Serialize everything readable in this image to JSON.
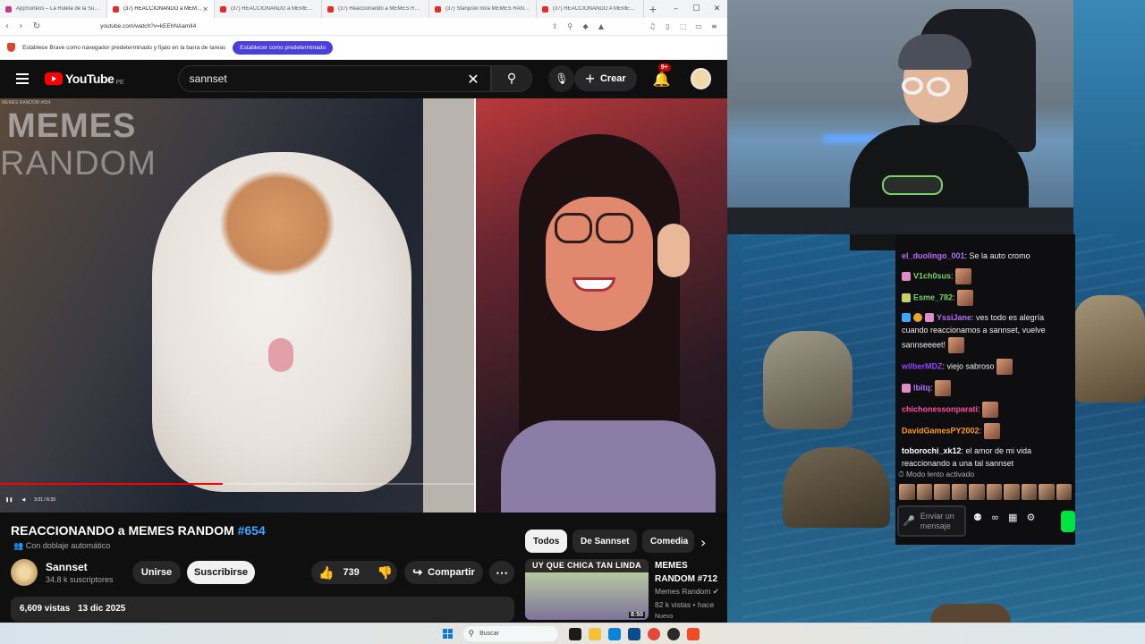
{
  "browser": {
    "tabs": [
      {
        "title": "AppSorteos – La Ruleta de la Suerte"
      },
      {
        "title": "(37) REACCIONANDO a MEMES R"
      },
      {
        "title": "(37) REACCIONANDO a MEMES RANDOM"
      },
      {
        "title": "(37) Reaccionando a MEMES RANDOM"
      },
      {
        "title": "(37) Stanjuski mira MEMES RANDOM"
      },
      {
        "title": "(37) REACCIONANDO A MEMES RANDOM"
      }
    ],
    "url": "youtube.com/watch?v=kEEhNAamlI4",
    "infobar_text": "Establece Brave como navegador predeterminado y fíjalo en la barra de tareas",
    "infobar_button": "Establecer como predeterminado"
  },
  "youtube": {
    "logo_text": "YouTube",
    "region": "PE",
    "search_value": "sannset",
    "create_label": "Crear",
    "notif_badge": "9+",
    "video": {
      "watermark_small": "MEMES RANDOM #654",
      "watermark_line1": "MEMES",
      "watermark_line2": "RANDOM",
      "time": "3:21 / 6:33",
      "progress": 0.47
    },
    "title_main": "REACCIONANDO a MEMES RANDOM ",
    "title_hash": "#654",
    "dubbing": "Con doblaje automático",
    "channel_name": "Sannset",
    "channel_subs": "34.8 k suscriptores",
    "join_label": "Unirse",
    "subscribe_label": "Suscribirse",
    "likes": "739",
    "share_label": "Compartir",
    "views": "6,609 vistas",
    "date": "13 dic 2025",
    "chips": [
      "Todos",
      "De Sannset",
      "Comedia"
    ],
    "rec": {
      "thumb_text": "UY QUE CHICA TAN LINDA",
      "duration": "8:50",
      "title": "MEMES RANDOM #712",
      "channel": "Memes Random",
      "meta": "82 k vistas • hace",
      "badge": "Nuevo"
    }
  },
  "chat": {
    "messages": [
      {
        "user": "el_duolingo_001",
        "color": "#9146ff",
        "text": ": Se la auto cromo",
        "emote": false
      },
      {
        "user": "V1ch0sus",
        "color": "#7ad36a",
        "text": ":",
        "emote": true
      },
      {
        "user": "Esme_782",
        "color": "#7ad36a",
        "text": ":",
        "emote": true
      },
      {
        "user": "YssiJane",
        "color": "#b76cff",
        "text": ": ves todo es alegría cuando reaccionamos a sannset, vuelve sannseeeet!",
        "emote": true
      },
      {
        "user": "wilberMDZ",
        "color": "#9146ff",
        "text": ": viejo sabroso",
        "emote": true
      },
      {
        "user": "lbitq",
        "color": "#b76cff",
        "text": ":",
        "emote": true
      },
      {
        "user": "chichonessonparati",
        "color": "#ff4fa3",
        "text": ":",
        "emote": true
      },
      {
        "user": "DavidGamesPY2002",
        "color": "#ff9a1f",
        "text": ":",
        "emote": true
      },
      {
        "user": "toborochi_xk12",
        "color": "#ffffff",
        "text": ": el amor de mi vida reaccionando a una tal sannset",
        "emote": false
      }
    ],
    "slow_mode": "Modo lento activado",
    "input_placeholder": "Enviar un mensaje"
  },
  "taskbar": {
    "search_placeholder": "Buscar"
  },
  "colors": {
    "youtube_red": "#ff0000",
    "twitch_purple": "#9146ff",
    "brave_button": "#4a3fd8",
    "send_green": "#00e340"
  }
}
